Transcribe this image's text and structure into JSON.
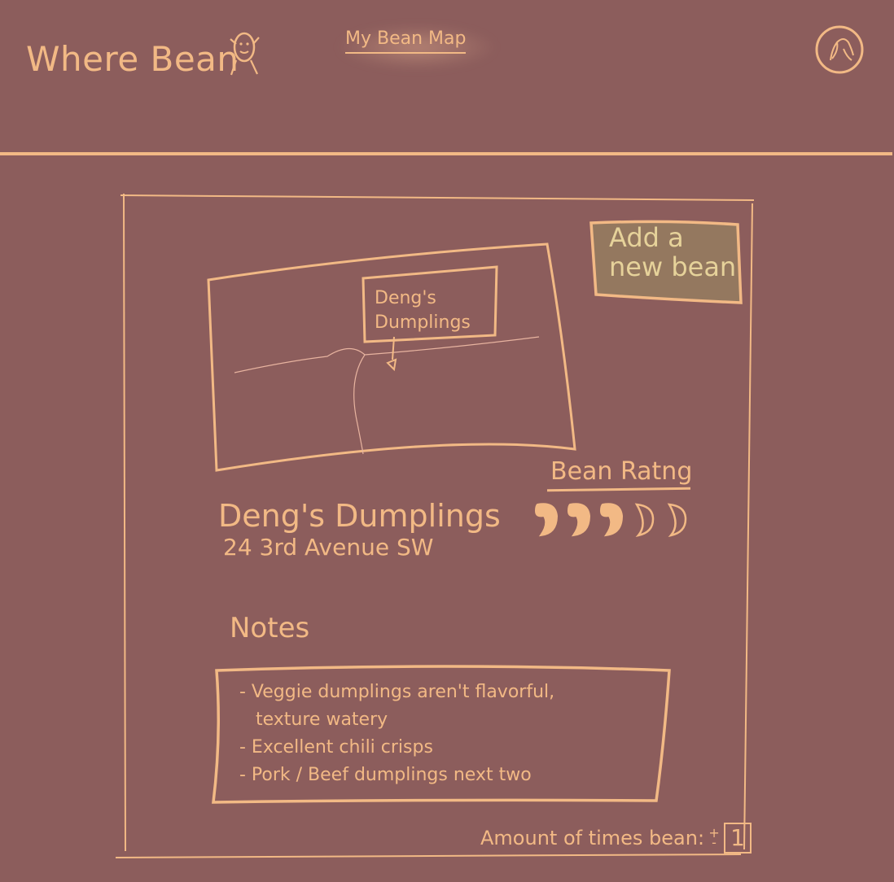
{
  "app": {
    "logo_text": "Where Bean",
    "nav_link": "My Bean Map"
  },
  "add_bean": {
    "label": "Add a\nnew bean"
  },
  "map": {
    "pin_label": "Deng's\nDumplings"
  },
  "place": {
    "name": "Deng's Dumplings",
    "address": "24 3rd Avenue SW"
  },
  "rating": {
    "title": "Bean Ratng",
    "value": 3,
    "max": 5
  },
  "notes": {
    "title": "Notes",
    "items": [
      "- Veggie dumplings aren't flavorful,",
      "texture watery",
      "- Excellent chili crisps",
      "- Pork / Beef dumplings next two"
    ]
  },
  "visits": {
    "label": "Amount of times bean:",
    "count": "1",
    "increment": "+",
    "decrement": "-"
  },
  "colors": {
    "background": "#8c5d5c",
    "ink": "#f2b985",
    "button_fill": "#94785f",
    "button_text": "#e6d29a"
  },
  "icons": {
    "logo": "bean-person-icon",
    "profile": "profile-avatar-icon",
    "pin": "map-pin-icon",
    "bean": "coffee-bean-icon"
  }
}
